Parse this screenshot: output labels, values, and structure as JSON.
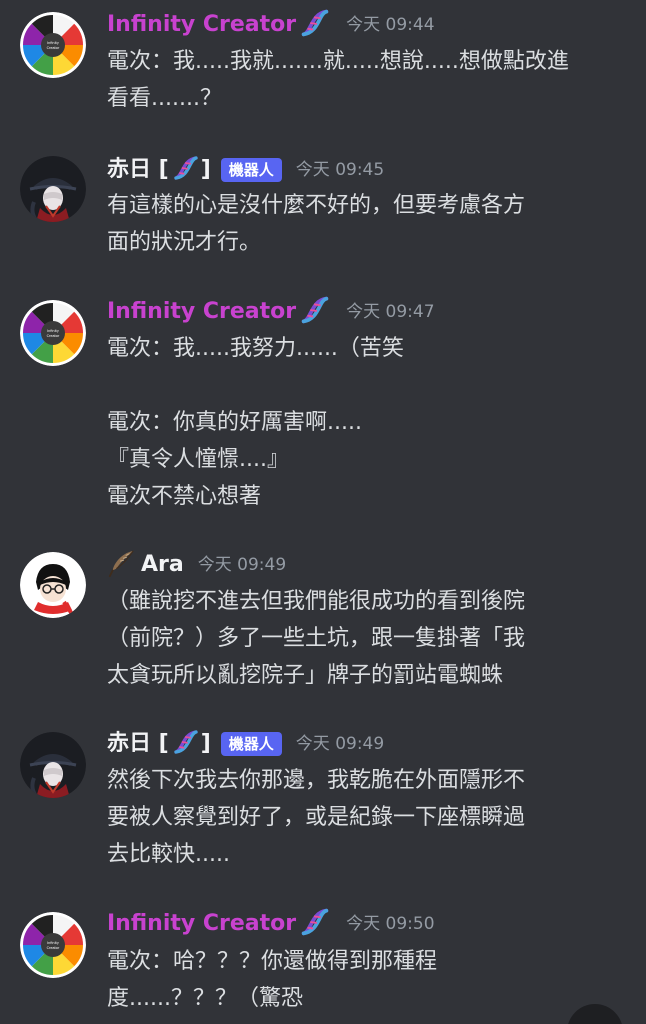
{
  "messages": [
    {
      "author": "Infinity Creator",
      "is_bot": false,
      "timestamp": "今天 09:44",
      "lines": [
        "電次：我.....我就.......就.....想說.....想做點改進",
        "看看.......？"
      ]
    },
    {
      "author": "赤日 [",
      "author_suffix": "]",
      "is_bot": true,
      "bot_label": "機器人",
      "timestamp": "今天 09:45",
      "lines": [
        "有這樣的心是沒什麼不好的，但要考慮各方",
        "面的狀況才行。"
      ]
    },
    {
      "author": "Infinity Creator",
      "is_bot": false,
      "timestamp": "今天 09:47",
      "lines": [
        "電次：我.....我努力......（苦笑",
        "",
        "電次：你真的好厲害啊.....",
        "『真令人憧憬....』",
        "電次不禁心想著"
      ]
    },
    {
      "author": "Ara",
      "is_bot": false,
      "timestamp": "今天 09:49",
      "lines": [
        "（雖說挖不進去但我們能很成功的看到後院",
        "（前院？）多了一些土坑，跟一隻掛著「我",
        "太貪玩所以亂挖院子」牌子的罰站電蜘蛛"
      ]
    },
    {
      "author": "赤日 [",
      "author_suffix": "]",
      "is_bot": true,
      "bot_label": "機器人",
      "timestamp": "今天 09:49",
      "lines": [
        "然後下次我去你那邊，我乾脆在外面隱形不",
        "要被人察覺到好了，或是紀錄一下座標瞬過",
        "去比較快....."
      ]
    },
    {
      "author": "Infinity Creator",
      "is_bot": false,
      "timestamp": "今天 09:50",
      "lines": [
        "電次：哈？？？你還做得到那種程",
        "度......？？？（驚恐"
      ]
    }
  ],
  "colors": {
    "background": "#313338",
    "infinity_name": "#c842cf",
    "text": "#dbdee1",
    "timestamp": "#949ba4",
    "bot_tag": "#5865f2"
  },
  "icons": {
    "dna": "dna-emoji-icon",
    "feather": "feather-icon"
  }
}
